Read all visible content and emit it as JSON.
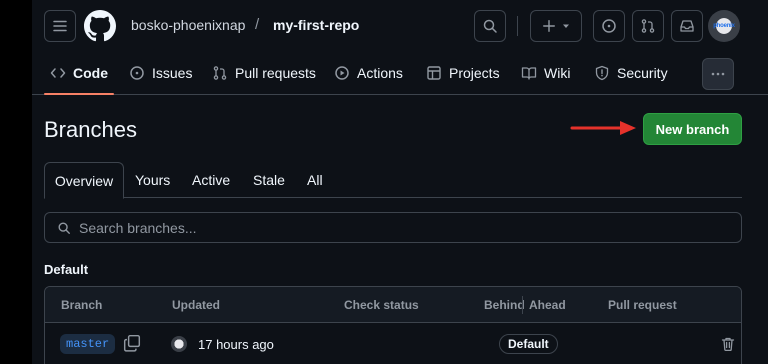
{
  "header": {
    "owner": "bosko-phoenixnap",
    "separator": "/",
    "repo": "my-first-repo",
    "avatar_text": "phoenix"
  },
  "repo_nav": {
    "tabs": [
      {
        "label": "Code",
        "icon": "code-icon",
        "selected": true
      },
      {
        "label": "Issues",
        "icon": "issue-icon"
      },
      {
        "label": "Pull requests",
        "icon": "pull-request-icon"
      },
      {
        "label": "Actions",
        "icon": "play-icon"
      },
      {
        "label": "Projects",
        "icon": "table-icon"
      },
      {
        "label": "Wiki",
        "icon": "book-icon"
      },
      {
        "label": "Security",
        "icon": "shield-icon"
      }
    ],
    "more_icon": "kebab-horizontal-icon"
  },
  "page": {
    "title": "Branches",
    "new_branch_label": "New branch"
  },
  "subtabs": [
    "Overview",
    "Yours",
    "Active",
    "Stale",
    "All"
  ],
  "search": {
    "placeholder": "Search branches..."
  },
  "section": {
    "label": "Default"
  },
  "table": {
    "columns": [
      "Branch",
      "Updated",
      "Check status",
      "Behind",
      "Ahead",
      "Pull request"
    ],
    "rows": [
      {
        "branch": "master",
        "updated": "17 hours ago",
        "badge": "Default"
      }
    ]
  },
  "colors": {
    "background": "#0d1117",
    "accent_green": "#238636",
    "underline": "#f78166",
    "arrow_red": "#e5322b",
    "link_blue": "#4493f8"
  }
}
